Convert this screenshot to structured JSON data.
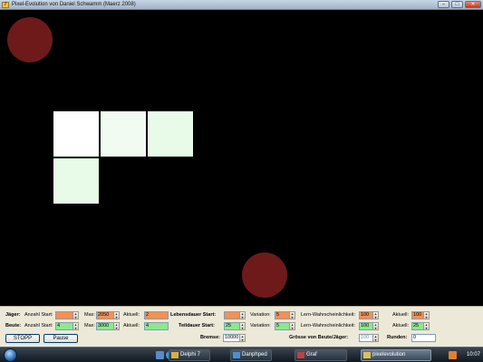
{
  "window": {
    "title": "Pixel-Evolution von Daniel Schwamm (Maerz 2008)",
    "minimize_glyph": "–",
    "maximize_glyph": "□",
    "close_glyph": "✕"
  },
  "canvas": {
    "circle_color": "#6e1a1a",
    "cells": [
      {
        "color": "#ffffff"
      },
      {
        "color": "#f2fbf2"
      },
      {
        "color": "#e8fbe8"
      },
      {
        "color": "#e8fbe8"
      }
    ]
  },
  "controls": {
    "jaeger": {
      "label": "Jäger:",
      "anzahl_start_label": "Anzahl Start:",
      "anzahl_start_value": "",
      "max_label": "Max:",
      "max_value": "2050",
      "aktuell_label": "Aktuell:",
      "aktuell_value": "2",
      "color": "#f79050"
    },
    "beute": {
      "label": "Beute:",
      "anzahl_start_label": "Anzahl Start:",
      "anzahl_start_value": "4",
      "max_label": "Max:",
      "max_value": "3000",
      "aktuell_label": "Aktuell:",
      "aktuell_value": "4",
      "color": "#8ce88c"
    },
    "lebensdauer": {
      "label": "Lebensdauer Start:",
      "value": "",
      "variation_label": "Variation:",
      "variation_value": "5",
      "lern_label": "Lern-Wahrscheinlichkeit:",
      "lern_value": "100",
      "aktuell_label": "Aktuell:",
      "aktuell_value": "100"
    },
    "teildauer": {
      "label": "Teildauer Start:",
      "value": "25",
      "variation_label": "Variation:",
      "variation_value": "5",
      "lern_label": "Lern-Wahrscheinlichkeit:",
      "lern_value": "100",
      "aktuell_label": "Aktuell:",
      "aktuell_value": "25"
    },
    "bremse": {
      "label": "Bremse:",
      "value": "10000"
    },
    "groesse": {
      "label": "Grösse von Beute/Jäger:",
      "value": "100"
    },
    "runden": {
      "label": "Runden:",
      "value": "0"
    },
    "stop_label": "STOPP",
    "pause_label": "Pause"
  },
  "taskbar": {
    "tasks": [
      {
        "label": "Delphi 7",
        "icon_color": "#d8b040"
      },
      {
        "label": "Danphped",
        "icon_color": "#4a90d0"
      },
      {
        "label": "Graf",
        "icon_color": "#c04040"
      },
      {
        "label": "pixelevolution",
        "icon_color": "#e0c050"
      }
    ],
    "clock": "10:07",
    "quicklaunch_icons": [
      "desktop-icon",
      "browser-icon",
      "explorer-icon"
    ]
  }
}
